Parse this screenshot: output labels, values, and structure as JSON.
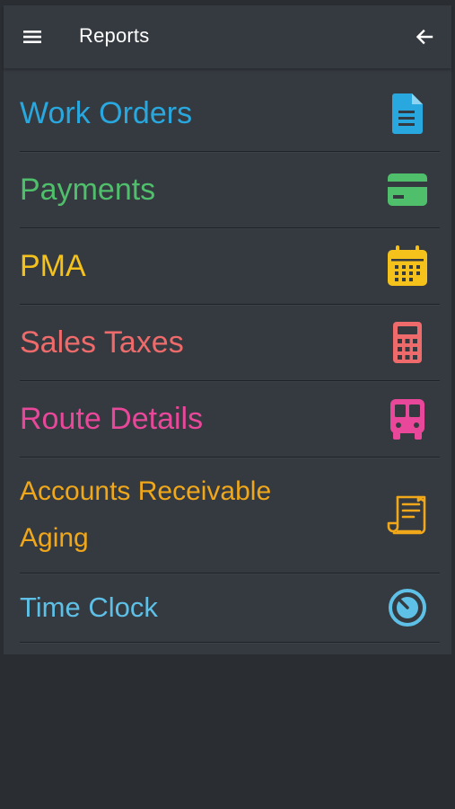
{
  "header": {
    "title": "Reports",
    "menu_icon": "hamburger-menu-icon",
    "back_icon": "arrow-left-icon"
  },
  "items": [
    {
      "label": "Work Orders",
      "icon": "document-icon",
      "color": "#29a8df"
    },
    {
      "label": "Payments",
      "icon": "credit-card-icon",
      "color": "#4fbf6b"
    },
    {
      "label": "PMA",
      "icon": "calendar-icon",
      "color": "#f5c21b"
    },
    {
      "label": "Sales Taxes",
      "icon": "calculator-icon",
      "color": "#ef6b6b"
    },
    {
      "label": "Route Details",
      "icon": "bus-icon",
      "color": "#e9489a"
    },
    {
      "label": "Accounts Receivable Aging",
      "icon": "receipt-scroll-icon",
      "color": "#f0a81a"
    },
    {
      "label": "Time Clock",
      "icon": "stopwatch-icon",
      "color": "#5ec0e6"
    }
  ],
  "colors": {
    "background": "#2a2e33",
    "panel": "#353a40",
    "title_text": "#ffffff"
  }
}
